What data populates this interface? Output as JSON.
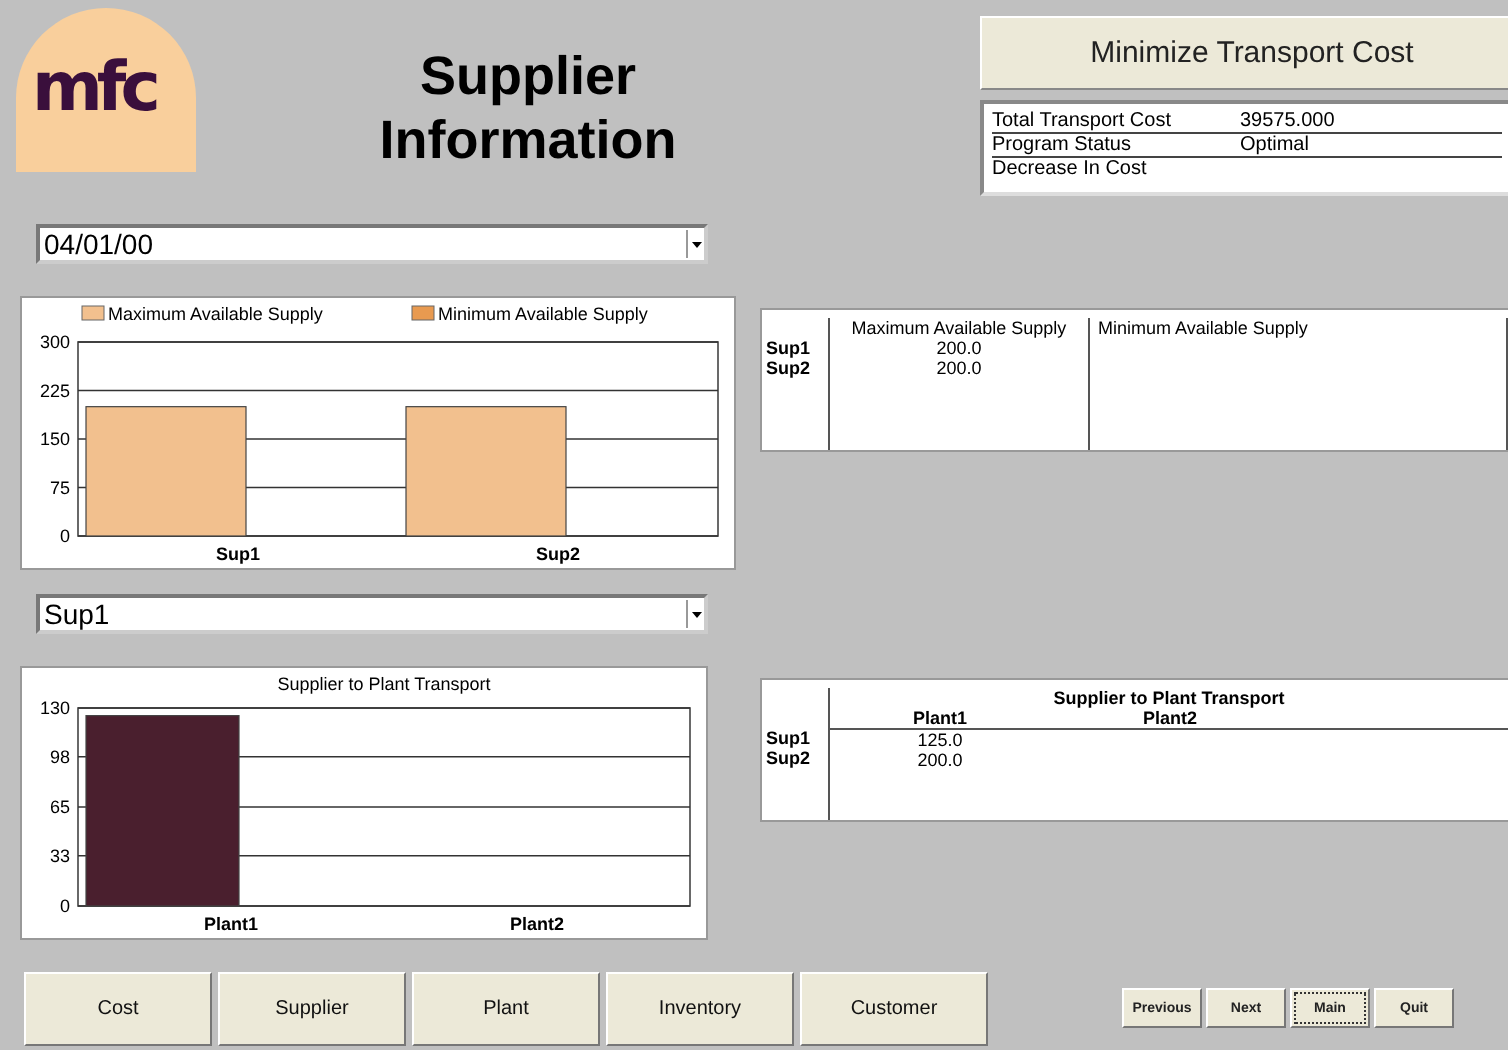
{
  "logo": {
    "text": "mfc"
  },
  "title": "Supplier Information",
  "action_button": "Minimize Transport Cost",
  "status": [
    {
      "label": "Total Transport Cost",
      "value": "39575.000"
    },
    {
      "label": "Program Status",
      "value": "Optimal"
    },
    {
      "label": "Decrease In Cost"
    }
  ],
  "date_select": {
    "value": "04/01/00"
  },
  "supply_chart": {
    "chart_data": {
      "type": "bar",
      "grid": true,
      "categories": [
        "Sup1",
        "Sup2"
      ],
      "ylim": [
        0,
        300
      ],
      "yticks": [
        0,
        75,
        150,
        225,
        300
      ],
      "series": [
        {
          "name": "Maximum Available Supply",
          "color": "#f2c08e",
          "values": [
            200,
            200
          ]
        },
        {
          "name": "Minimum Available Supply",
          "color": "#e89a50",
          "values": [
            null,
            null
          ]
        }
      ]
    }
  },
  "supply_table": {
    "columns": [
      "Maximum Available Supply",
      "Minimum Available Supply"
    ],
    "rows": [
      {
        "name": "Sup1",
        "cells": [
          "200.0",
          null
        ]
      },
      {
        "name": "Sup2",
        "cells": [
          "200.0",
          null
        ]
      }
    ]
  },
  "supplier_select": {
    "value": "Sup1"
  },
  "transport_chart": {
    "chart_data": {
      "type": "bar",
      "grid": true,
      "title": "Supplier to Plant Transport",
      "categories": [
        "Plant1",
        "Plant2"
      ],
      "ylim": [
        0,
        130
      ],
      "yticks": [
        0,
        33,
        65,
        98,
        130
      ],
      "series": [
        {
          "color": "#4a1f2e",
          "values": [
            125,
            null
          ]
        }
      ]
    }
  },
  "transport_table": {
    "title": "Supplier to Plant Transport",
    "columns": [
      "Plant1",
      "Plant2"
    ],
    "rows": [
      {
        "name": "Sup1",
        "cells": [
          "125.0",
          null
        ]
      },
      {
        "name": "Sup2",
        "cells": [
          "200.0",
          null
        ]
      }
    ]
  },
  "nav_buttons": [
    "Cost",
    "Supplier",
    "Plant",
    "Inventory",
    "Customer"
  ],
  "small_buttons": [
    {
      "label": "Previous",
      "focused": false
    },
    {
      "label": "Next",
      "focused": false
    },
    {
      "label": "Main",
      "focused": true
    },
    {
      "label": "Quit",
      "focused": false
    }
  ]
}
